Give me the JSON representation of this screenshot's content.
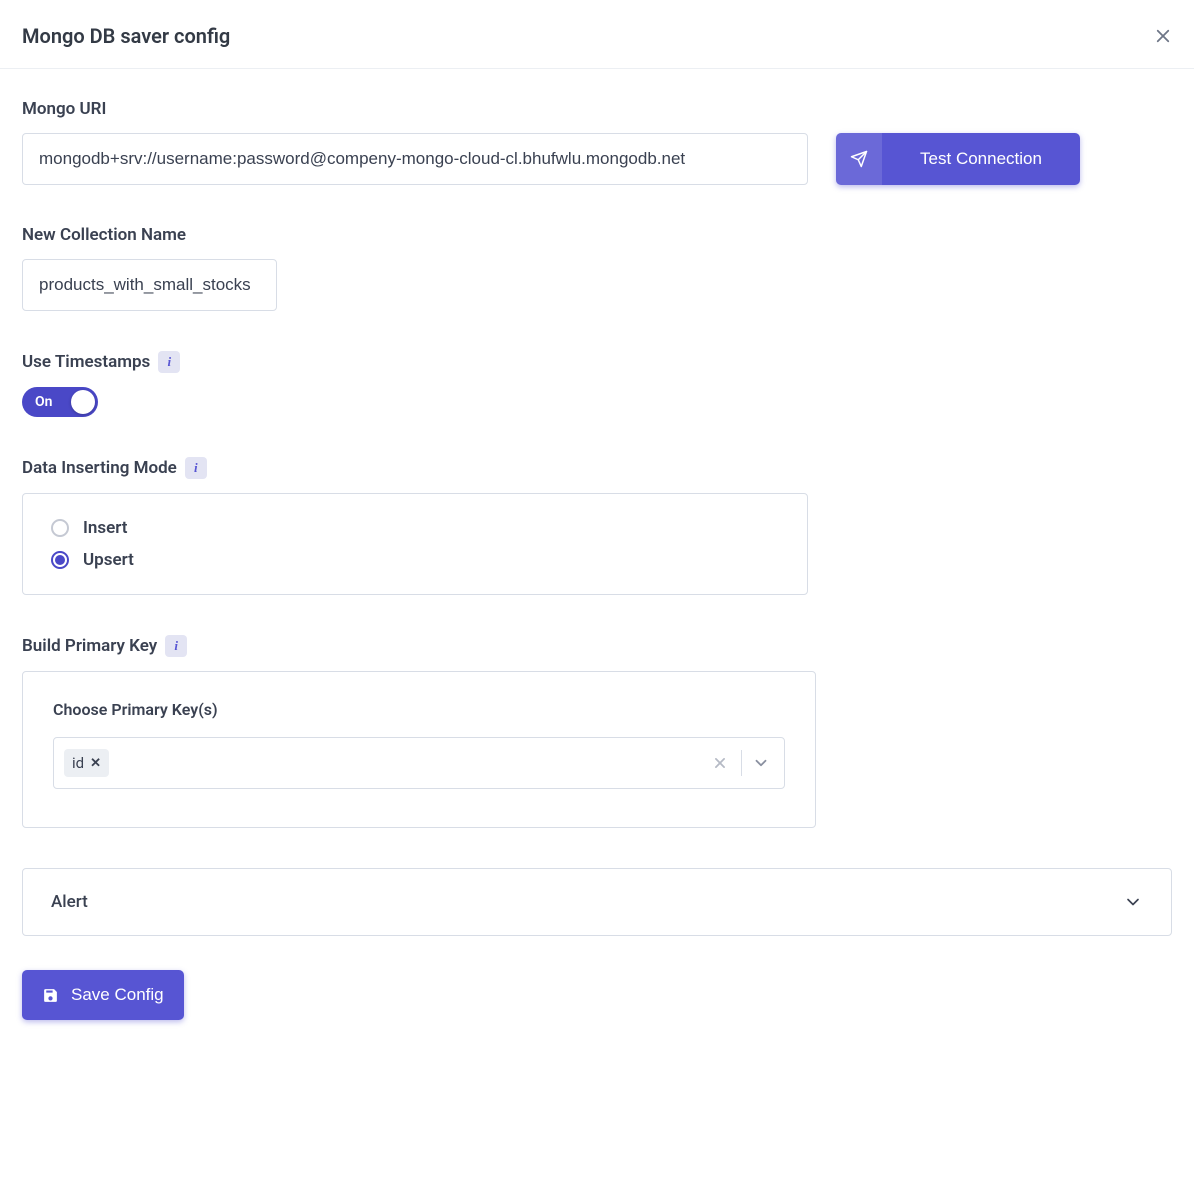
{
  "header": {
    "title": "Mongo DB saver config"
  },
  "uri": {
    "label": "Mongo URI",
    "value": "mongodb+srv://username:password@compeny-mongo-cloud-cl.bhufwlu.mongodb.net",
    "test_button": "Test Connection"
  },
  "collection": {
    "label": "New Collection Name",
    "value": "products_with_small_stocks"
  },
  "timestamps": {
    "label": "Use Timestamps",
    "toggle_text": "On"
  },
  "inserting_mode": {
    "label": "Data Inserting Mode",
    "options": [
      {
        "label": "Insert",
        "checked": false
      },
      {
        "label": "Upsert",
        "checked": true
      }
    ]
  },
  "primary_key": {
    "label": "Build Primary Key",
    "sublabel": "Choose Primary Key(s)",
    "selected": [
      "id"
    ]
  },
  "alert": {
    "label": "Alert"
  },
  "footer": {
    "save_label": "Save Config"
  }
}
